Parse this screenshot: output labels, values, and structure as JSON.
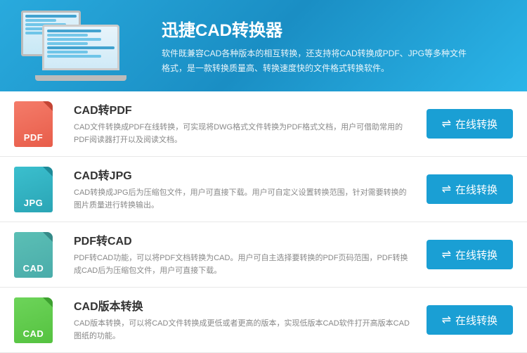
{
  "header": {
    "title": "迅捷CAD转换器",
    "description": "软件既兼容CAD各种版本的相互转换，还支持将CAD转换成PDF、JPG等多种文件格式，是一款转换质量高、转换速度快的文件格式转换软件。"
  },
  "items": [
    {
      "id": "cad-to-pdf",
      "icon_type": "pdf",
      "icon_label": "PDF",
      "title": "CAD转PDF",
      "description": "CAD文件转换成PDF在线转换，可实现将DWG格式文件转换为PDF格式文档，用户可借助常用的PDF阅读器打开以及阅读文档。",
      "btn_label": "在线转换"
    },
    {
      "id": "cad-to-jpg",
      "icon_type": "jpg",
      "icon_label": "JPG",
      "title": "CAD转JPG",
      "description": "CAD转换成JPG后为压缩包文件，用户可直接下载。用户可自定义设置转换范围，针对需要转换的图片质量进行转换输出。",
      "btn_label": "在线转换"
    },
    {
      "id": "pdf-to-cad",
      "icon_type": "cad_gray",
      "icon_label": "CAD",
      "title": "PDF转CAD",
      "description": "PDF转CAD功能，可以将PDF文档转换为CAD。用户可自主选择要转换的PDF页码范围，PDF转换成CAD后为压缩包文件，用户可直接下载。",
      "btn_label": "在线转换"
    },
    {
      "id": "cad-version",
      "icon_type": "cad_green",
      "icon_label": "CAD",
      "title": "CAD版本转换",
      "description": "CAD版本转换，可以将CAD文件转换成更低或者更高的版本，实现低版本CAD软件打开高版本CAD图纸的功能。",
      "btn_label": "在线转换"
    }
  ]
}
